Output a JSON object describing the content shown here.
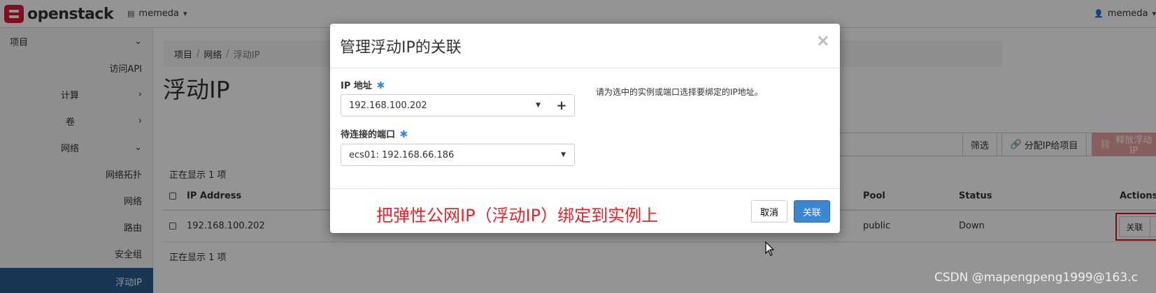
{
  "brand": {
    "name": "openstack"
  },
  "header": {
    "project": "memeda",
    "user": "memeda"
  },
  "sidebar": {
    "items": [
      {
        "label": "项目",
        "chevron": "down"
      },
      {
        "label": "访问API",
        "chevron": ""
      },
      {
        "label": "计算",
        "chevron": "right"
      },
      {
        "label": "卷",
        "chevron": "right"
      },
      {
        "label": "网络",
        "chevron": "down"
      },
      {
        "label": "网络拓扑",
        "chevron": ""
      },
      {
        "label": "网络",
        "chevron": ""
      },
      {
        "label": "路由",
        "chevron": ""
      },
      {
        "label": "安全组",
        "chevron": ""
      },
      {
        "label": "浮动IP",
        "chevron": "",
        "active": true
      }
    ]
  },
  "breadcrumb": [
    "项目",
    "网络",
    "浮动IP"
  ],
  "page": {
    "title": "浮动IP",
    "count_text": "正在显示 1 项",
    "filter_button": "筛选",
    "allocate_button": "分配IP给项目",
    "release_button": "释放浮动IP"
  },
  "table": {
    "headers": {
      "ip": "IP Address",
      "pool": "Pool",
      "status": "Status",
      "actions": "Actions"
    },
    "rows": [
      {
        "ip": "192.168.100.202",
        "pool": "public",
        "status": "Down",
        "action": "关联"
      }
    ]
  },
  "modal": {
    "title": "管理浮动IP的关联",
    "ip_label": "IP 地址",
    "ip_value": "192.168.100.202",
    "port_label": "待连接的端口",
    "port_value": "ecs01: 192.168.66.186",
    "help": "请为选中的实例或端口选择要绑定的IP地址。",
    "required_mark": "✱",
    "close": "×",
    "cancel": "取消",
    "associate": "关联"
  },
  "annotation": "把弹性公网IP（浮动IP）绑定到实例上",
  "watermark": "CSDN @mapengpeng1999@163.c",
  "colors": {
    "primary": "#3a87d4",
    "danger_light": "#e8a4a2",
    "annotation_red": "#e8232a",
    "sidebar_active": "#2a5d8f"
  }
}
